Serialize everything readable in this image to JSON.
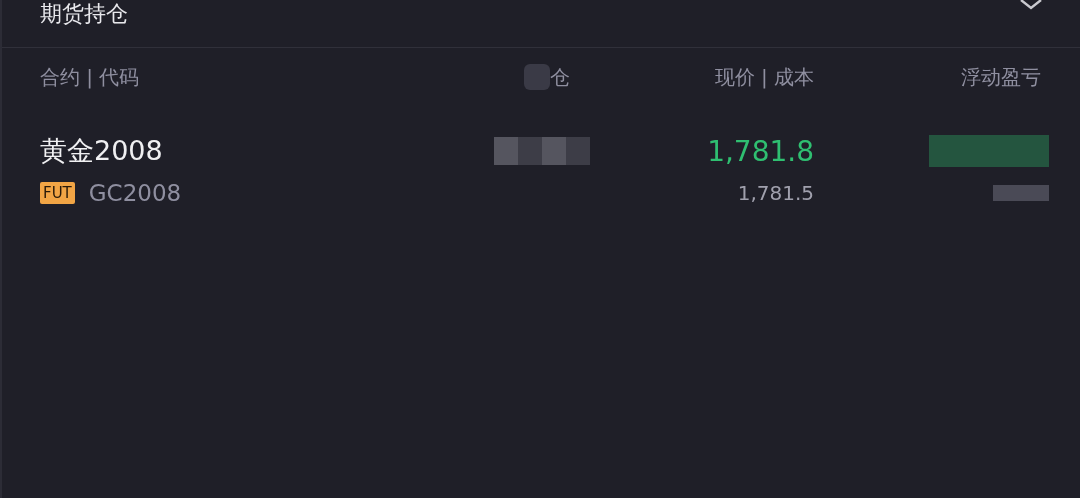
{
  "title": "期货持仓",
  "columns": [
    {
      "label": "合约 | 代码"
    },
    {
      "label": "仓"
    },
    {
      "label": "现价 | 成本"
    },
    {
      "label": "浮动盈亏"
    }
  ],
  "positions": [
    {
      "name": "黄金2008",
      "tag": "FUT",
      "code": "GC2008",
      "price": "1,781.8",
      "cost": "1,781.5",
      "rising": true
    }
  ]
}
